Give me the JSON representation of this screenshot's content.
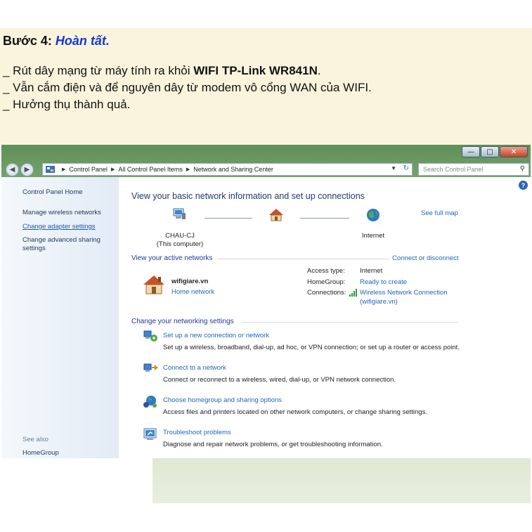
{
  "note": {
    "step_label": "Bước 4:",
    "step_title": "Hoàn tất.",
    "line1_prefix": "_ Rút dây mạng từ máy tính ra khỏi ",
    "line1_bold": "WIFI TP-Link WR841N",
    "line1_suffix": ".",
    "line2": "_ Vẫn cắm điện và để nguyên dây từ modem vô cổng WAN của WIFI.",
    "line3": "_ Hưởng thụ thành quả."
  },
  "window": {
    "controls": {
      "minimize": "—",
      "maximize": "□",
      "close": "✕"
    },
    "breadcrumb": [
      "Control Panel",
      "All Control Panel Items",
      "Network and Sharing Center"
    ],
    "search_placeholder": "Search Control Panel"
  },
  "sidebar": {
    "home": "Control Panel Home",
    "items": [
      "Manage wireless networks",
      "Change adapter settings",
      "Change advanced sharing settings"
    ],
    "see_also": "See also",
    "see_also_items": [
      "HomeGroup"
    ]
  },
  "main": {
    "help": "?",
    "title": "View your basic network information and set up connections",
    "see_full_map": "See full map",
    "computer_name": "CHAU-CJ",
    "computer_sub": "(This computer)",
    "internet": "Internet",
    "active_title": "View your active networks",
    "connect_disconnect": "Connect or disconnect",
    "network_name": "wifigiare.vn",
    "network_type": "Home network",
    "details": {
      "access_type_label": "Access type:",
      "access_type_value": "Internet",
      "homegroup_label": "HomeGroup:",
      "homegroup_value": "Ready to create",
      "connections_label": "Connections:",
      "connections_value": "Wireless Network Connection",
      "connections_sub": "(wifigiare.vn)"
    },
    "settings_title": "Change your networking settings",
    "tasks": [
      {
        "title": "Set up a new connection or network",
        "desc": "Set up a wireless, broadband, dial-up, ad hoc, or VPN connection; or set up a router or access point."
      },
      {
        "title": "Connect to a network",
        "desc": "Connect or reconnect to a wireless, wired, dial-up, or VPN network connection."
      },
      {
        "title": "Choose homegroup and sharing options",
        "desc": "Access files and printers located on other network computers, or change sharing settings."
      },
      {
        "title": "Troubleshoot problems",
        "desc": "Diagnose and repair network problems, or get troubleshooting information."
      }
    ]
  }
}
